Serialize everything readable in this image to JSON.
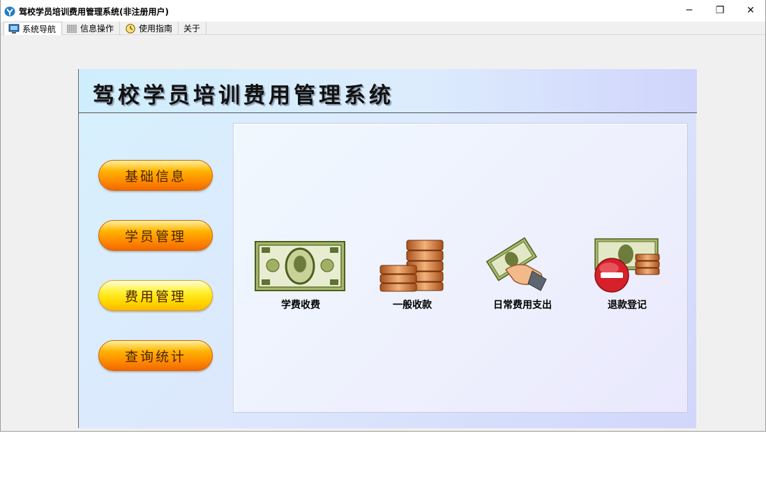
{
  "window": {
    "title": "驾校学员培训费用管理系统(非注册用户)",
    "controls": {
      "minimize": "─",
      "maximize": "❐",
      "close": "✕"
    }
  },
  "menu": {
    "tabs": [
      {
        "label": "系统导航",
        "icon": "monitor-icon"
      },
      {
        "label": "信息操作",
        "icon": "grid-icon"
      },
      {
        "label": "使用指南",
        "icon": "clock-icon"
      },
      {
        "label": "关于",
        "icon": ""
      }
    ]
  },
  "panel": {
    "title": "驾校学员培训费用管理系统",
    "sidebar": [
      {
        "label": "基础信息"
      },
      {
        "label": "学员管理"
      },
      {
        "label": "费用管理"
      },
      {
        "label": "查询统计"
      }
    ],
    "functions": [
      {
        "label": "学费收费",
        "icon": "banknote-icon"
      },
      {
        "label": "一般收款",
        "icon": "coins-icon"
      },
      {
        "label": "日常费用支出",
        "icon": "hand-money-icon"
      },
      {
        "label": "退款登记",
        "icon": "refund-icon"
      }
    ]
  },
  "colors": {
    "button_orange": "#ff8a00",
    "button_selected_yellow": "#fff23a",
    "panel_bg": "#dde8fd"
  }
}
